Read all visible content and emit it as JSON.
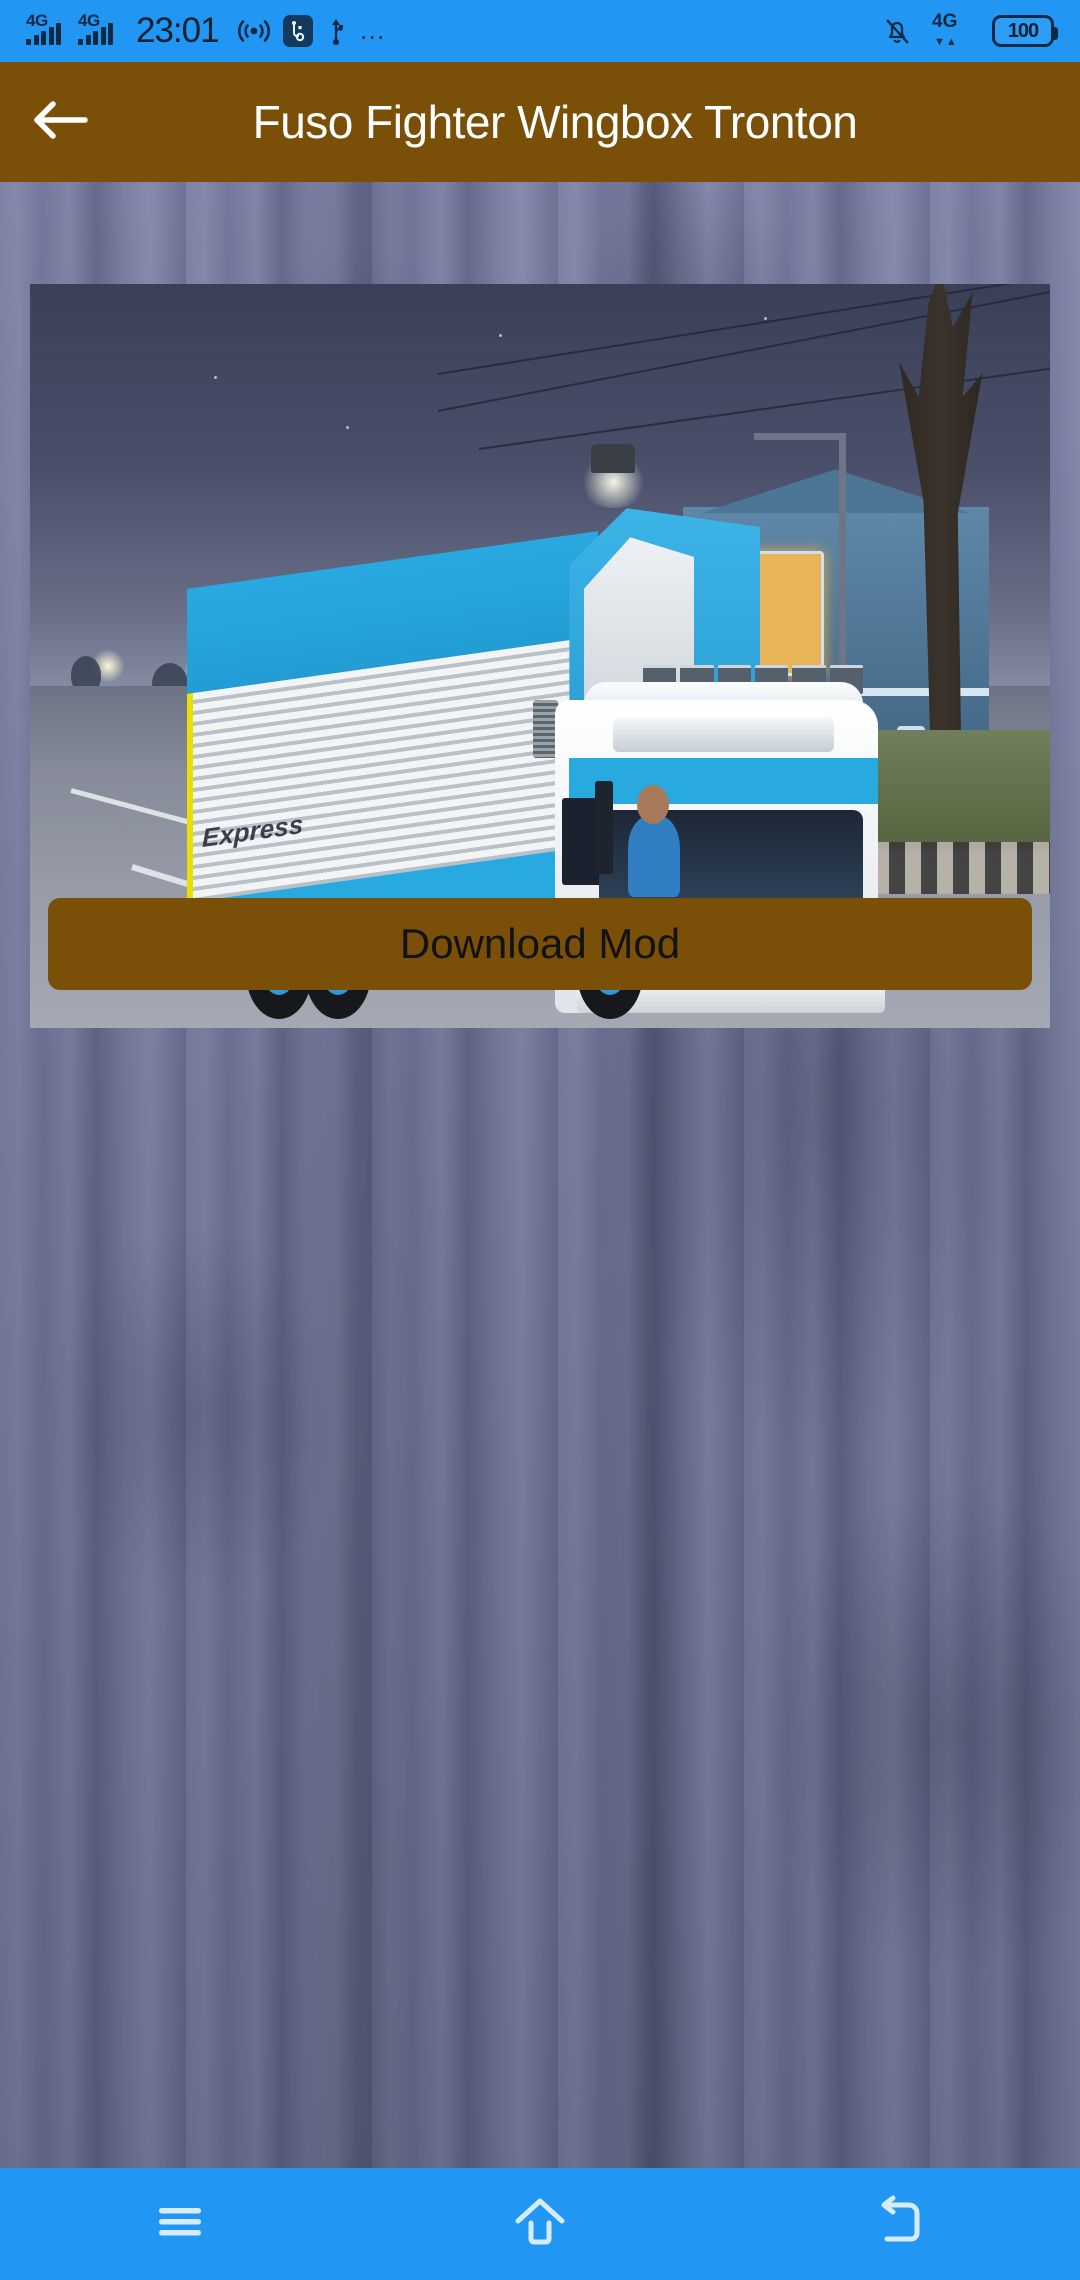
{
  "status_bar": {
    "time": "23:01",
    "battery_level": "100",
    "network_left": "4G",
    "network_left_2": "4G",
    "network_right": "4G",
    "overflow": "…",
    "icons": [
      "signal-4g-icon",
      "signal-4g-icon",
      "hotspot-icon",
      "usb-debugging-icon",
      "usb-icon",
      "more-dots-icon",
      "notifications-muted-icon",
      "mobile-data-4g-icon",
      "battery-icon"
    ],
    "accent_color": "#2196f3"
  },
  "app_bar": {
    "title": "Fuso Fighter Wingbox Tronton",
    "back_icon": "arrow-left-icon",
    "background_color": "#7a5008",
    "title_color": "#ffffff"
  },
  "content": {
    "mod_preview_alt": "Fuso Fighter Wingbox Tronton truck mod screenshot",
    "download_button_label": "Download Mod",
    "download_button_color": "#7a5008",
    "background_texture": "grunge-concrete"
  },
  "nav_bar": {
    "background_color": "#2196f3",
    "buttons": [
      {
        "name": "recents-button",
        "icon": "menu-icon"
      },
      {
        "name": "home-button",
        "icon": "home-icon"
      },
      {
        "name": "back-button",
        "icon": "back-arrow-icon"
      }
    ]
  }
}
